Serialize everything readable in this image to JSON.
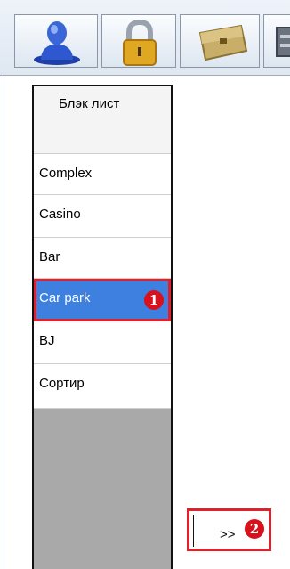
{
  "toolbar": {
    "buttons": [
      {
        "icon": "user-icon"
      },
      {
        "icon": "lock-icon"
      },
      {
        "icon": "chest-icon"
      },
      {
        "icon": "partial-icon"
      }
    ]
  },
  "list": {
    "header": "Блэк лист",
    "items": [
      {
        "label": "Complex"
      },
      {
        "label": "Casino"
      },
      {
        "label": "Bar"
      },
      {
        "label": "Car park",
        "selected": true,
        "badge": "1"
      },
      {
        "label": "BJ"
      },
      {
        "label": "Сортир"
      }
    ]
  },
  "next_button": {
    "label": ">>",
    "badge": "2"
  },
  "colors": {
    "selection": "#3d80e0",
    "highlight": "#e0202a",
    "badge": "#d8121c"
  }
}
